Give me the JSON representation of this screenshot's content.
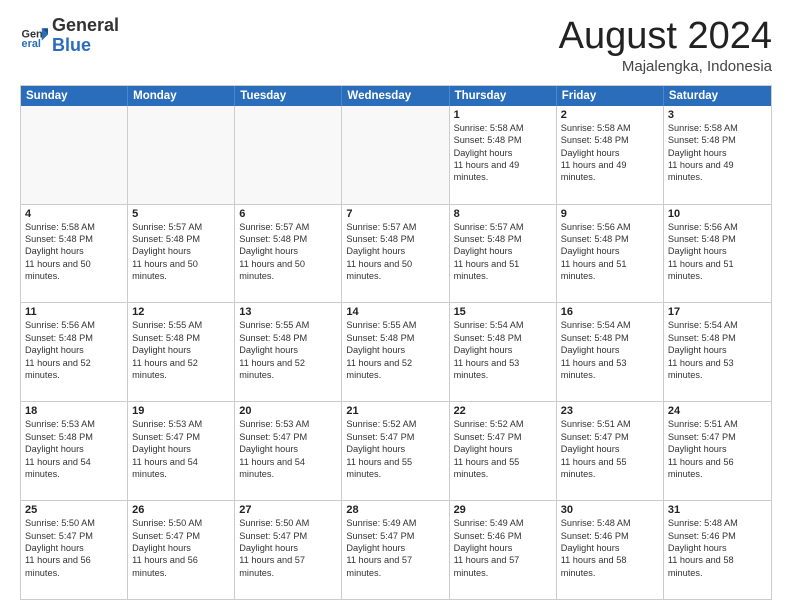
{
  "header": {
    "logo_general": "General",
    "logo_blue": "Blue",
    "month": "August 2024",
    "location": "Majalengka, Indonesia"
  },
  "days_of_week": [
    "Sunday",
    "Monday",
    "Tuesday",
    "Wednesday",
    "Thursday",
    "Friday",
    "Saturday"
  ],
  "weeks": [
    [
      {
        "day": "",
        "data": "",
        "shaded": true
      },
      {
        "day": "",
        "data": "",
        "shaded": true
      },
      {
        "day": "",
        "data": "",
        "shaded": true
      },
      {
        "day": "",
        "data": "",
        "shaded": true
      },
      {
        "day": "1",
        "sunrise": "5:58 AM",
        "sunset": "5:48 PM",
        "daylight": "11 hours and 49 minutes."
      },
      {
        "day": "2",
        "sunrise": "5:58 AM",
        "sunset": "5:48 PM",
        "daylight": "11 hours and 49 minutes."
      },
      {
        "day": "3",
        "sunrise": "5:58 AM",
        "sunset": "5:48 PM",
        "daylight": "11 hours and 49 minutes."
      }
    ],
    [
      {
        "day": "4",
        "sunrise": "5:58 AM",
        "sunset": "5:48 PM",
        "daylight": "11 hours and 50 minutes."
      },
      {
        "day": "5",
        "sunrise": "5:57 AM",
        "sunset": "5:48 PM",
        "daylight": "11 hours and 50 minutes."
      },
      {
        "day": "6",
        "sunrise": "5:57 AM",
        "sunset": "5:48 PM",
        "daylight": "11 hours and 50 minutes."
      },
      {
        "day": "7",
        "sunrise": "5:57 AM",
        "sunset": "5:48 PM",
        "daylight": "11 hours and 50 minutes."
      },
      {
        "day": "8",
        "sunrise": "5:57 AM",
        "sunset": "5:48 PM",
        "daylight": "11 hours and 51 minutes."
      },
      {
        "day": "9",
        "sunrise": "5:56 AM",
        "sunset": "5:48 PM",
        "daylight": "11 hours and 51 minutes."
      },
      {
        "day": "10",
        "sunrise": "5:56 AM",
        "sunset": "5:48 PM",
        "daylight": "11 hours and 51 minutes."
      }
    ],
    [
      {
        "day": "11",
        "sunrise": "5:56 AM",
        "sunset": "5:48 PM",
        "daylight": "11 hours and 52 minutes."
      },
      {
        "day": "12",
        "sunrise": "5:55 AM",
        "sunset": "5:48 PM",
        "daylight": "11 hours and 52 minutes."
      },
      {
        "day": "13",
        "sunrise": "5:55 AM",
        "sunset": "5:48 PM",
        "daylight": "11 hours and 52 minutes."
      },
      {
        "day": "14",
        "sunrise": "5:55 AM",
        "sunset": "5:48 PM",
        "daylight": "11 hours and 52 minutes."
      },
      {
        "day": "15",
        "sunrise": "5:54 AM",
        "sunset": "5:48 PM",
        "daylight": "11 hours and 53 minutes."
      },
      {
        "day": "16",
        "sunrise": "5:54 AM",
        "sunset": "5:48 PM",
        "daylight": "11 hours and 53 minutes."
      },
      {
        "day": "17",
        "sunrise": "5:54 AM",
        "sunset": "5:48 PM",
        "daylight": "11 hours and 53 minutes."
      }
    ],
    [
      {
        "day": "18",
        "sunrise": "5:53 AM",
        "sunset": "5:48 PM",
        "daylight": "11 hours and 54 minutes."
      },
      {
        "day": "19",
        "sunrise": "5:53 AM",
        "sunset": "5:47 PM",
        "daylight": "11 hours and 54 minutes."
      },
      {
        "day": "20",
        "sunrise": "5:53 AM",
        "sunset": "5:47 PM",
        "daylight": "11 hours and 54 minutes."
      },
      {
        "day": "21",
        "sunrise": "5:52 AM",
        "sunset": "5:47 PM",
        "daylight": "11 hours and 55 minutes."
      },
      {
        "day": "22",
        "sunrise": "5:52 AM",
        "sunset": "5:47 PM",
        "daylight": "11 hours and 55 minutes."
      },
      {
        "day": "23",
        "sunrise": "5:51 AM",
        "sunset": "5:47 PM",
        "daylight": "11 hours and 55 minutes."
      },
      {
        "day": "24",
        "sunrise": "5:51 AM",
        "sunset": "5:47 PM",
        "daylight": "11 hours and 56 minutes."
      }
    ],
    [
      {
        "day": "25",
        "sunrise": "5:50 AM",
        "sunset": "5:47 PM",
        "daylight": "11 hours and 56 minutes."
      },
      {
        "day": "26",
        "sunrise": "5:50 AM",
        "sunset": "5:47 PM",
        "daylight": "11 hours and 56 minutes."
      },
      {
        "day": "27",
        "sunrise": "5:50 AM",
        "sunset": "5:47 PM",
        "daylight": "11 hours and 57 minutes."
      },
      {
        "day": "28",
        "sunrise": "5:49 AM",
        "sunset": "5:47 PM",
        "daylight": "11 hours and 57 minutes."
      },
      {
        "day": "29",
        "sunrise": "5:49 AM",
        "sunset": "5:46 PM",
        "daylight": "11 hours and 57 minutes."
      },
      {
        "day": "30",
        "sunrise": "5:48 AM",
        "sunset": "5:46 PM",
        "daylight": "11 hours and 58 minutes."
      },
      {
        "day": "31",
        "sunrise": "5:48 AM",
        "sunset": "5:46 PM",
        "daylight": "11 hours and 58 minutes."
      }
    ]
  ]
}
